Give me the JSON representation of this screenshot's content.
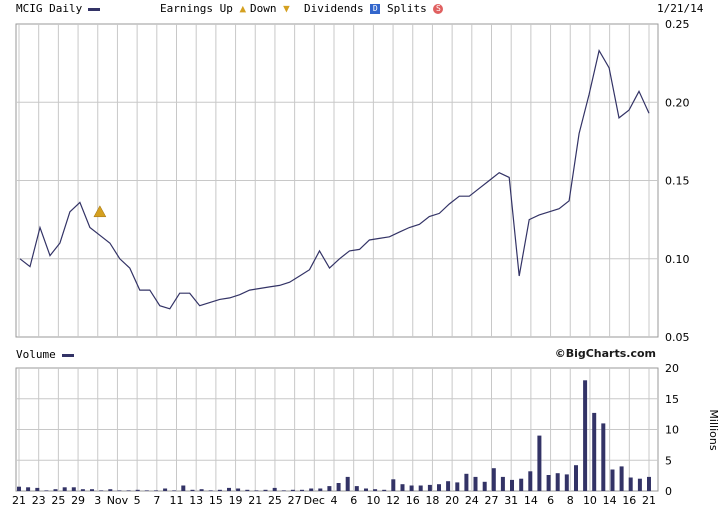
{
  "legend": {
    "symbol_period": "MCIG Daily",
    "earnings_up": "Earnings Up",
    "down": "Down",
    "dividends": "Dividends",
    "dividend_icon_text": "D",
    "splits": "Splits",
    "split_icon_text": "S",
    "date": "1/21/14"
  },
  "volume_header": {
    "label": "Volume",
    "brand": "©BigCharts.com"
  },
  "colors": {
    "series": "#333366",
    "grid": "#c8c8c8",
    "earnings": "#d4a020",
    "dividend": "#3366cc",
    "split": "#e06060"
  },
  "chart_data": [
    {
      "type": "line",
      "x": [
        "21",
        "22",
        "23",
        "24",
        "25",
        "28",
        "29",
        "30",
        "31",
        "1",
        "4",
        "5",
        "6",
        "7",
        "8",
        "11",
        "12",
        "13",
        "14",
        "15",
        "18",
        "19",
        "20",
        "21",
        "22",
        "25",
        "26",
        "27",
        "29",
        "2",
        "3",
        "4",
        "5",
        "6",
        "9",
        "10",
        "11",
        "12",
        "13",
        "16",
        "17",
        "18",
        "19",
        "20",
        "23",
        "24",
        "26",
        "27",
        "30",
        "31",
        "2",
        "3",
        "6",
        "7",
        "8",
        "9",
        "10",
        "13",
        "14",
        "15",
        "16",
        "17",
        "21"
      ],
      "values": [
        0.1,
        0.095,
        0.12,
        0.102,
        0.11,
        0.13,
        0.136,
        0.12,
        0.115,
        0.11,
        0.1,
        0.094,
        0.08,
        0.08,
        0.07,
        0.068,
        0.078,
        0.078,
        0.07,
        0.072,
        0.074,
        0.075,
        0.077,
        0.08,
        0.081,
        0.082,
        0.083,
        0.085,
        0.089,
        0.093,
        0.105,
        0.094,
        0.1,
        0.105,
        0.106,
        0.112,
        0.113,
        0.114,
        0.117,
        0.12,
        0.122,
        0.127,
        0.129,
        0.135,
        0.14,
        0.14,
        0.145,
        0.15,
        0.155,
        0.152,
        0.089,
        0.125,
        0.128,
        0.13,
        0.132,
        0.137,
        0.18,
        0.205,
        0.233,
        0.222,
        0.19,
        0.195,
        0.207,
        0.193
      ],
      "y_ticks": [
        "0.25",
        "0.20",
        "0.15",
        "0.10",
        "0.05"
      ],
      "ylim": [
        0.05,
        0.25
      ],
      "earnings_marker_index": 8,
      "grid": true
    },
    {
      "type": "bar",
      "x_tick_labels": [
        "21",
        "23",
        "25",
        "29",
        "3",
        "Nov",
        "5",
        "7",
        "11",
        "13",
        "15",
        "19",
        "21",
        "25",
        "27",
        "Dec",
        "4",
        "6",
        "10",
        "12",
        "16",
        "18",
        "20",
        "24",
        "27",
        "31",
        "14",
        "6",
        "8",
        "10",
        "14",
        "16",
        "21"
      ],
      "values": [
        0.7,
        0.6,
        0.5,
        0.1,
        0.3,
        0.6,
        0.6,
        0.3,
        0.3,
        0.1,
        0.3,
        0.1,
        0.1,
        0.2,
        0.1,
        0.1,
        0.4,
        0.1,
        0.9,
        0.2,
        0.3,
        0.1,
        0.2,
        0.5,
        0.4,
        0.2,
        0.1,
        0.2,
        0.5,
        0.1,
        0.2,
        0.2,
        0.4,
        0.4,
        0.8,
        1.3,
        2.3,
        0.8,
        0.4,
        0.3,
        0.2,
        1.9,
        1.1,
        0.9,
        0.9,
        1.0,
        1.1,
        1.6,
        1.4,
        2.8,
        2.3,
        1.5,
        3.7,
        2.3,
        1.8,
        2.0,
        3.2,
        9.0,
        2.6,
        2.9,
        2.7,
        4.2,
        18.0,
        12.7,
        11.0,
        3.5,
        4.0,
        2.2,
        2.0,
        2.3
      ],
      "y_ticks": [
        "20",
        "15",
        "10",
        "5",
        "0"
      ],
      "ylabel": "Millions",
      "ylim": [
        0,
        20
      ],
      "grid": true
    }
  ]
}
